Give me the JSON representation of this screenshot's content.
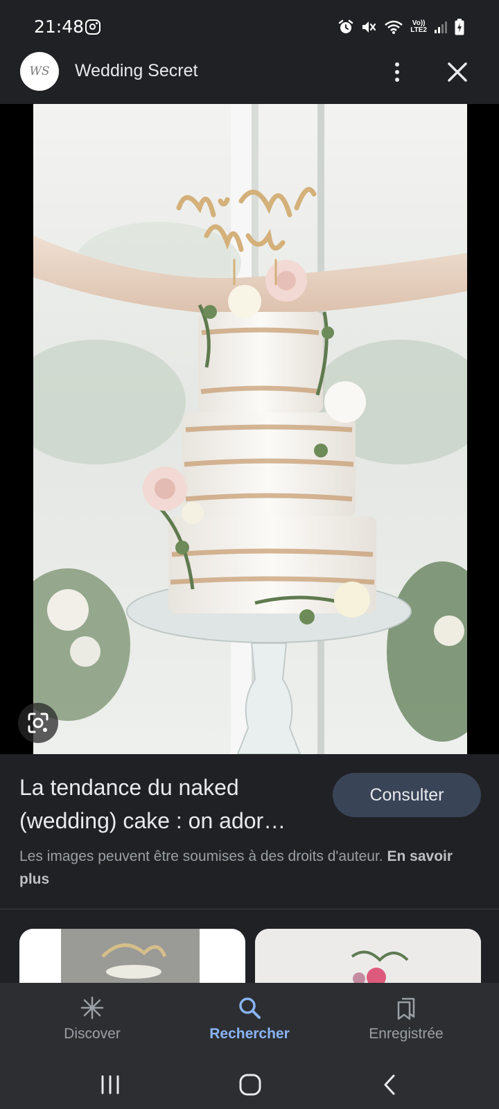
{
  "status_bar": {
    "time": "21:48",
    "network_label_top": "Vo))",
    "network_label_bottom": "LTE2"
  },
  "header": {
    "avatar_text": "WS",
    "site_name": "Wedding Secret"
  },
  "image": {
    "topper_text": "Mr & Mrs"
  },
  "result": {
    "title": "La tendance du naked (wedding) cake : on ador…",
    "visit_label": "Consulter",
    "copyright_text": "Les images peuvent être soumises à des droits d'auteur. ",
    "learn_more_label": "En savoir plus"
  },
  "bottom_nav": {
    "items": [
      {
        "label": "Discover",
        "icon": "asterisk-icon"
      },
      {
        "label": "Rechercher",
        "icon": "search-icon"
      },
      {
        "label": "Enregistrée",
        "icon": "collections-icon"
      }
    ],
    "active_index": 1
  },
  "colors": {
    "background": "#202124",
    "accent": "#8ab4f8",
    "button": "#394457"
  }
}
